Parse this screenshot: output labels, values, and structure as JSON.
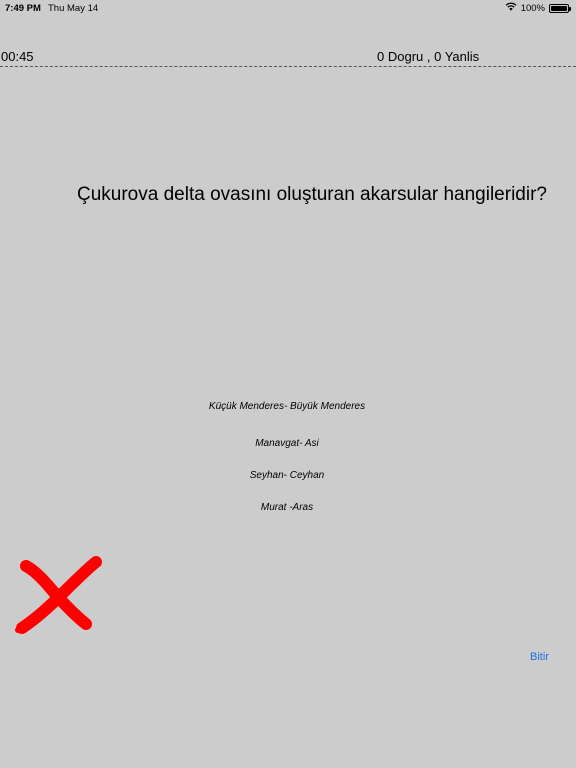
{
  "status_bar": {
    "time": "7:49 PM",
    "date": "Thu May 14",
    "battery": "100%",
    "battery_level": 1.0,
    "icons": [
      "wifi-icon",
      "battery-icon"
    ]
  },
  "quiz": {
    "timer": "00:45",
    "score": "0 Dogru , 0 Yanlis",
    "question": "Çukurova delta ovasını oluşturan akarsular hangileridir?",
    "answers": [
      "Küçük Menderes- Büyük Menderes",
      "Manavgat- Asi",
      "Seyhan- Ceyhan",
      "Murat -Aras"
    ],
    "result_icon": "wrong-cross-icon",
    "finish_label": "Bitir"
  },
  "colors": {
    "background": "#cccccc",
    "wrong_mark": "#ff0000",
    "finish_link": "#1a73e8"
  }
}
